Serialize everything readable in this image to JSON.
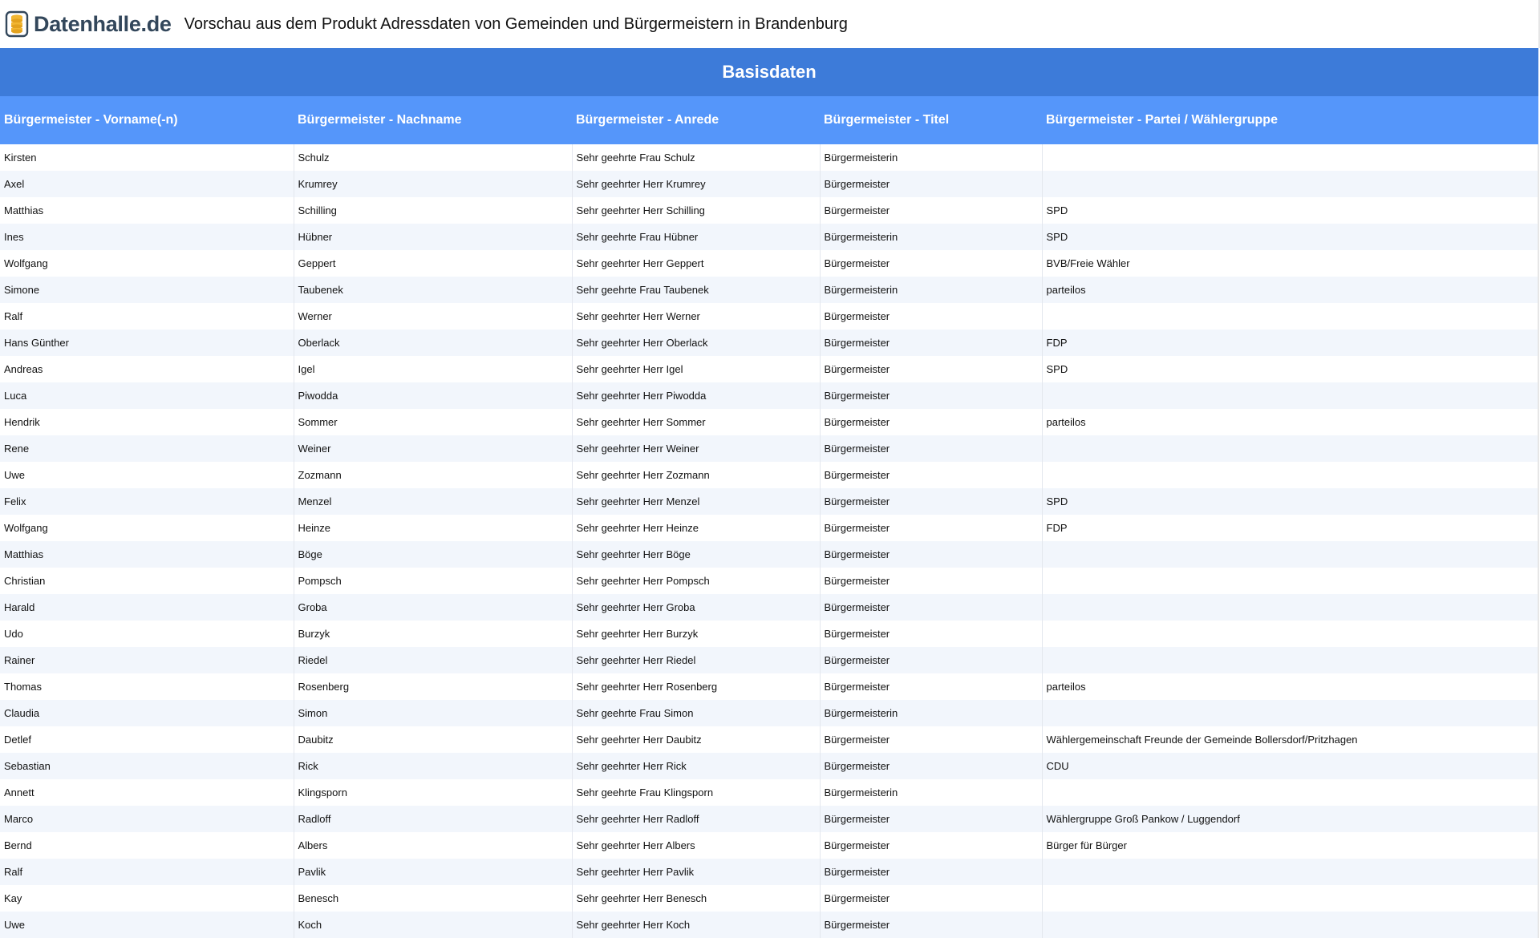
{
  "header": {
    "logo_text": "Datenhalle.de",
    "title": "Vorschau aus dem Produkt Adressdaten von Gemeinden und Bürgermeistern in Brandenburg"
  },
  "table": {
    "section_title": "Basisdaten",
    "columns": [
      "Bürgermeister - Vorname(-n)",
      "Bürgermeister - Nachname",
      "Bürgermeister - Anrede",
      "Bürgermeister - Titel",
      "Bürgermeister - Partei / Wählergruppe"
    ],
    "rows": [
      [
        "Kirsten",
        "Schulz",
        "Sehr geehrte Frau Schulz",
        "Bürgermeisterin",
        ""
      ],
      [
        "Axel",
        "Krumrey",
        "Sehr geehrter Herr Krumrey",
        "Bürgermeister",
        ""
      ],
      [
        "Matthias",
        "Schilling",
        "Sehr geehrter Herr Schilling",
        "Bürgermeister",
        "SPD"
      ],
      [
        "Ines",
        "Hübner",
        "Sehr geehrte Frau Hübner",
        "Bürgermeisterin",
        "SPD"
      ],
      [
        "Wolfgang",
        "Geppert",
        "Sehr geehrter Herr Geppert",
        "Bürgermeister",
        "BVB/Freie Wähler"
      ],
      [
        "Simone",
        "Taubenek",
        "Sehr geehrte Frau Taubenek",
        "Bürgermeisterin",
        "parteilos"
      ],
      [
        "Ralf",
        "Werner",
        "Sehr geehrter Herr Werner",
        "Bürgermeister",
        ""
      ],
      [
        "Hans Günther",
        "Oberlack",
        "Sehr geehrter Herr Oberlack",
        "Bürgermeister",
        "FDP"
      ],
      [
        "Andreas",
        "Igel",
        "Sehr geehrter Herr Igel",
        "Bürgermeister",
        "SPD"
      ],
      [
        "Luca",
        "Piwodda",
        "Sehr geehrter Herr Piwodda",
        "Bürgermeister",
        ""
      ],
      [
        "Hendrik",
        "Sommer",
        "Sehr geehrter Herr Sommer",
        "Bürgermeister",
        "parteilos"
      ],
      [
        "Rene",
        "Weiner",
        "Sehr geehrter Herr Weiner",
        "Bürgermeister",
        ""
      ],
      [
        "Uwe",
        "Zozmann",
        "Sehr geehrter Herr Zozmann",
        "Bürgermeister",
        ""
      ],
      [
        "Felix",
        "Menzel",
        "Sehr geehrter Herr Menzel",
        "Bürgermeister",
        "SPD"
      ],
      [
        "Wolfgang",
        "Heinze",
        "Sehr geehrter Herr Heinze",
        "Bürgermeister",
        "FDP"
      ],
      [
        "Matthias",
        "Böge",
        "Sehr geehrter Herr Böge",
        "Bürgermeister",
        ""
      ],
      [
        "Christian",
        "Pompsch",
        "Sehr geehrter Herr Pompsch",
        "Bürgermeister",
        ""
      ],
      [
        "Harald",
        "Groba",
        "Sehr geehrter Herr Groba",
        "Bürgermeister",
        ""
      ],
      [
        "Udo",
        "Burzyk",
        "Sehr geehrter Herr Burzyk",
        "Bürgermeister",
        ""
      ],
      [
        "Rainer",
        "Riedel",
        "Sehr geehrter Herr Riedel",
        "Bürgermeister",
        ""
      ],
      [
        "Thomas",
        "Rosenberg",
        "Sehr geehrter Herr Rosenberg",
        "Bürgermeister",
        "parteilos"
      ],
      [
        "Claudia",
        "Simon",
        "Sehr geehrte Frau Simon",
        "Bürgermeisterin",
        ""
      ],
      [
        "Detlef",
        "Daubitz",
        "Sehr geehrter Herr Daubitz",
        "Bürgermeister",
        "Wählergemeinschaft Freunde der Gemeinde Bollersdorf/Pritzhagen"
      ],
      [
        "Sebastian",
        "Rick",
        "Sehr geehrter Herr Rick",
        "Bürgermeister",
        "CDU"
      ],
      [
        "Annett",
        "Klingsporn",
        "Sehr geehrte Frau Klingsporn",
        "Bürgermeisterin",
        ""
      ],
      [
        "Marco",
        "Radloff",
        "Sehr geehrter Herr Radloff",
        "Bürgermeister",
        "Wählergruppe Groß Pankow / Luggendorf"
      ],
      [
        "Bernd",
        "Albers",
        "Sehr geehrter Herr Albers",
        "Bürgermeister",
        "Bürger für Bürger"
      ],
      [
        "Ralf",
        "Pavlik",
        "Sehr geehrter Herr Pavlik",
        "Bürgermeister",
        ""
      ],
      [
        "Kay",
        "Benesch",
        "Sehr geehrter Herr Benesch",
        "Bürgermeister",
        ""
      ],
      [
        "Uwe",
        "Koch",
        "Sehr geehrter Herr Koch",
        "Bürgermeister",
        ""
      ]
    ]
  },
  "icons": {
    "logo": "database-stack-icon"
  },
  "colors": {
    "section_header_bg": "#3d7bd9",
    "column_header_bg": "#5596fa",
    "row_alt_bg": "#f2f6fc",
    "logo_accent": "#f2b632",
    "logo_text": "#33475b"
  }
}
